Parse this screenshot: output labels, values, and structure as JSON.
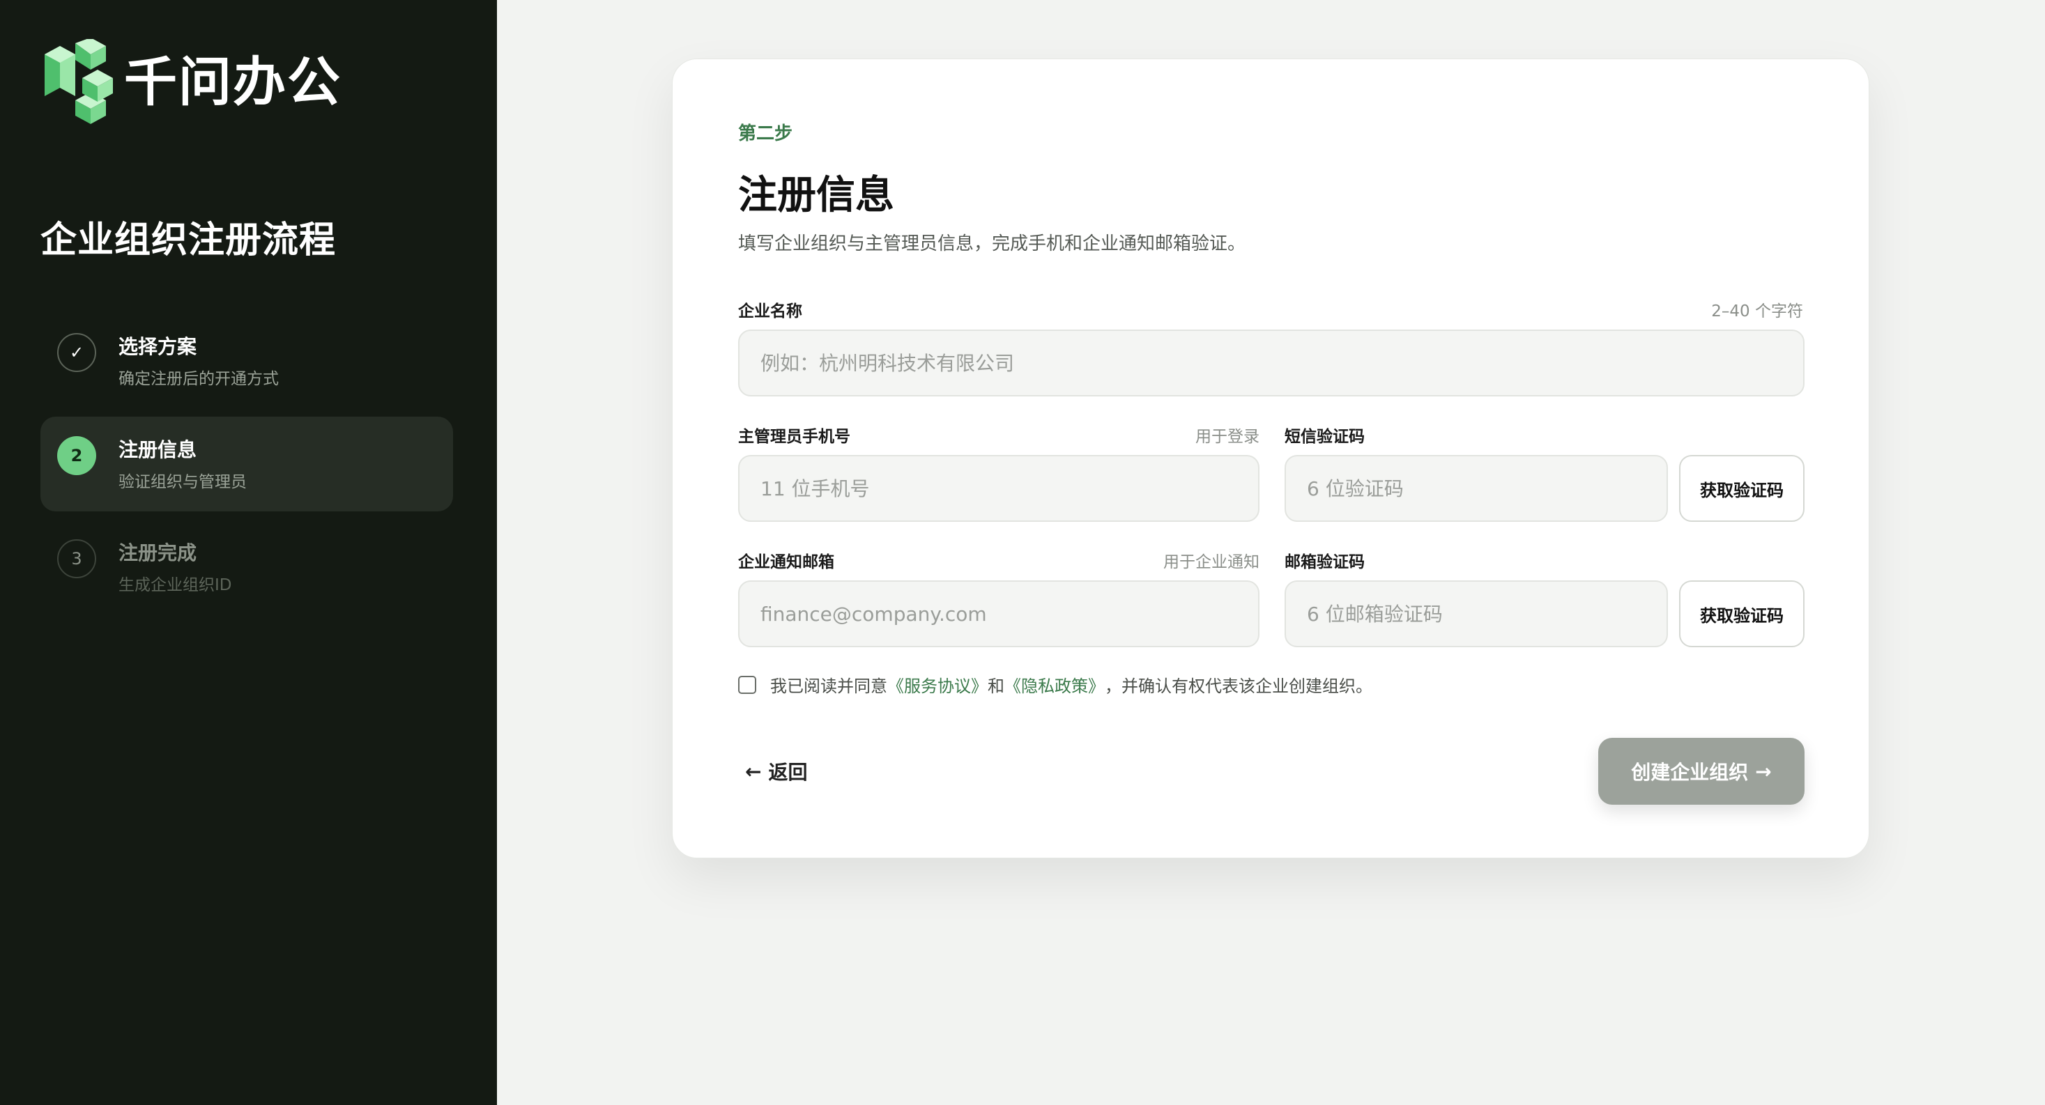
{
  "brand": {
    "name": "千问办公",
    "logo_icon": "cube-logo-icon",
    "accent_color": "#6fcf86"
  },
  "sidebar": {
    "title": "企业组织注册流程",
    "steps": [
      {
        "number": "✓",
        "title": "选择方案",
        "subtitle": "确定注册后的开通方式",
        "state": "done"
      },
      {
        "number": "2",
        "title": "注册信息",
        "subtitle": "验证组织与管理员",
        "state": "active"
      },
      {
        "number": "3",
        "title": "注册完成",
        "subtitle": "生成企业组织ID",
        "state": "todo"
      }
    ]
  },
  "form": {
    "eyebrow": "第二步",
    "title": "注册信息",
    "description": "填写企业组织与主管理员信息，完成手机和企业通知邮箱验证。",
    "company_name": {
      "label": "企业名称",
      "hint": "2–40 个字符",
      "placeholder": "例如：杭州明科技术有限公司",
      "value": ""
    },
    "phone": {
      "label": "主管理员手机号",
      "hint": "用于登录",
      "placeholder": "11 位手机号",
      "value": ""
    },
    "sms_code": {
      "label": "短信验证码",
      "placeholder": "6 位验证码",
      "value": "",
      "button_label": "获取验证码"
    },
    "email": {
      "label": "企业通知邮箱",
      "hint": "用于企业通知",
      "placeholder": "finance@company.com",
      "value": ""
    },
    "email_code": {
      "label": "邮箱验证码",
      "placeholder": "6 位邮箱验证码",
      "value": "",
      "button_label": "获取验证码"
    },
    "agreement": {
      "checked": false,
      "text_before": "我已阅读并同意",
      "service_link": "《服务协议》",
      "and_text": "和",
      "privacy_link": "《隐私政策》",
      "text_after": "，并确认有权代表该企业创建组织。"
    },
    "back_label": "返回",
    "submit_label": "创建企业组织"
  }
}
